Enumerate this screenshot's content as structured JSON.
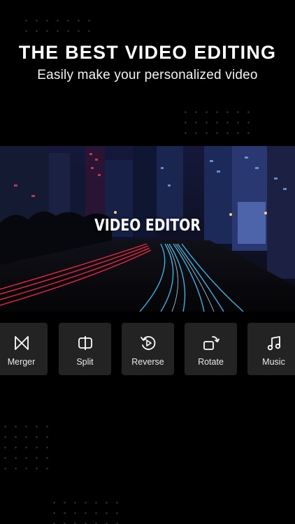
{
  "header": {
    "title": "THE BEST VIDEO EDITING",
    "subtitle": "Easily make your personalized video"
  },
  "hero": {
    "overlay_text": "VIDEO EDITOR"
  },
  "tools": [
    {
      "label": "Merger",
      "icon": "merge-icon"
    },
    {
      "label": "Split",
      "icon": "split-icon"
    },
    {
      "label": "Reverse",
      "icon": "reverse-icon"
    },
    {
      "label": "Rotate",
      "icon": "rotate-icon"
    },
    {
      "label": "Music",
      "icon": "music-note-icon"
    }
  ],
  "colors": {
    "background": "#000000",
    "tile": "#232323",
    "text": "#ffffff",
    "light_trail_red": "#ff2a4a",
    "light_trail_blue": "#38c8ff"
  }
}
